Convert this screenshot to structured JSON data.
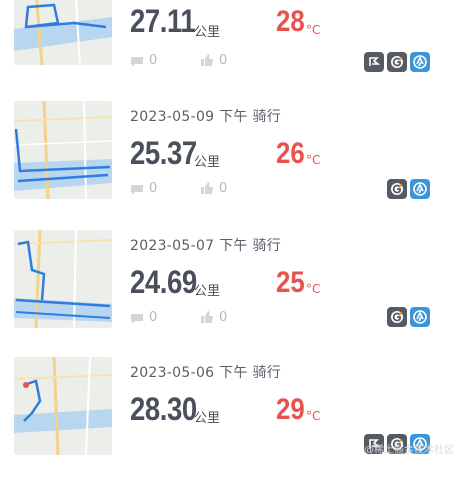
{
  "activities": [
    {
      "date": "",
      "distance": "27.11",
      "distance_unit": "公里",
      "temperature": "28",
      "temp_unit": "°C",
      "comments": "0",
      "likes": "0",
      "badges": [
        "route-badge-icon",
        "g-badge-icon",
        "strava-badge-icon"
      ]
    },
    {
      "date": "2023-05-09 下午 骑行",
      "distance": "25.37",
      "distance_unit": "公里",
      "temperature": "26",
      "temp_unit": "°C",
      "comments": "0",
      "likes": "0",
      "badges": [
        "g-badge-icon",
        "strava-badge-icon"
      ]
    },
    {
      "date": "2023-05-07 下午 骑行",
      "distance": "24.69",
      "distance_unit": "公里",
      "temperature": "25",
      "temp_unit": "°C",
      "comments": "0",
      "likes": "0",
      "badges": [
        "g-badge-icon",
        "strava-badge-icon"
      ]
    },
    {
      "date": "2023-05-06 下午 骑行",
      "distance": "28.30",
      "distance_unit": "公里",
      "temperature": "29",
      "temp_unit": "°C",
      "comments": "0",
      "likes": "0",
      "badges": [
        "route-badge-icon",
        "g-badge-icon",
        "strava-badge-icon"
      ]
    }
  ],
  "watermark": "@稀土掘金技术社区",
  "colors": {
    "temperature": "#e8534d",
    "strava": "#3a96d8",
    "badge_dark": "#555a63",
    "route": "#2f7de0"
  }
}
